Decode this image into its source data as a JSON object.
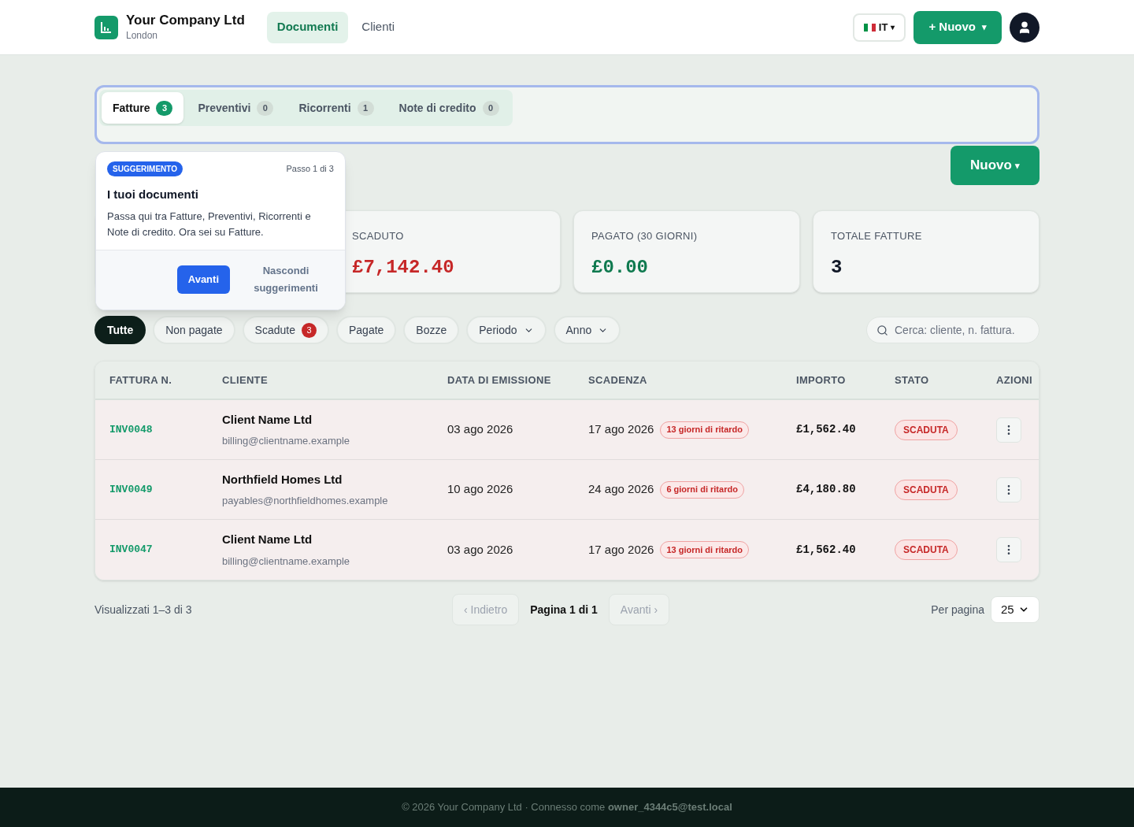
{
  "header": {
    "company": "Your Company Ltd",
    "city": "London",
    "nav": [
      {
        "label": "Documenti",
        "selected": true
      },
      {
        "label": "Clienti",
        "selected": false
      }
    ],
    "language": {
      "code": "IT",
      "caret": "▾"
    },
    "new_button": {
      "label": "+ Nuovo",
      "caret": "▾"
    }
  },
  "doc_tabs": [
    {
      "label": "Fatture",
      "count": "3",
      "selected": true
    },
    {
      "label": "Preventivi",
      "count": "0",
      "selected": false
    },
    {
      "label": "Ricorrenti",
      "count": "1",
      "selected": false
    },
    {
      "label": "Note di credito",
      "count": "0",
      "selected": false
    }
  ],
  "new_button": {
    "label": "Nuovo",
    "caret": "▾"
  },
  "tour": {
    "badge": "SUGGERIMENTO",
    "step": "Passo 1 di 3",
    "title": "I tuoi documenti",
    "body": "Passa qui tra Fatture, Preventivi, Ricorrenti e Note di credito. Ora sei su Fatture.",
    "next": "Avanti",
    "hide": "Nascondi suggerimenti"
  },
  "stats": [
    {
      "label": "SCADUTO",
      "value": "£7,142.40",
      "color": "#c62828"
    },
    {
      "label": "PAGATO (30 GIORNI)",
      "value": "£0.00",
      "color": "#0f7a4f"
    },
    {
      "label": "TOTALE FATTURE",
      "value": "3",
      "color": "#111827"
    }
  ],
  "filters": [
    {
      "label": "Tutte",
      "kind": "chip",
      "selected": true
    },
    {
      "label": "Non pagate",
      "kind": "chip",
      "selected": false
    },
    {
      "label": "Scadute",
      "kind": "chip",
      "count": "3",
      "selected": false
    },
    {
      "label": "Pagate",
      "kind": "chip",
      "selected": false
    },
    {
      "label": "Bozze",
      "kind": "chip",
      "selected": false
    },
    {
      "label": "Periodo",
      "kind": "dropdown",
      "selected": false
    },
    {
      "label": "Anno",
      "kind": "dropdown",
      "selected": false
    }
  ],
  "search": {
    "placeholder": "Cerca: cliente, n. fattura."
  },
  "table": {
    "columns": [
      "FATTURA N.",
      "CLIENTE",
      "DATA DI EMISSIONE",
      "SCADENZA",
      "IMPORTO",
      "STATO",
      "AZIONI"
    ],
    "rows": [
      {
        "number": "INV0048",
        "client": "Client Name Ltd",
        "email": "billing@clientname.example",
        "issued": "03 ago 2026",
        "due": "17 ago 2026",
        "late": "13 giorni di ritardo",
        "amount": "£1,562.40",
        "status": "SCADUTA"
      },
      {
        "number": "INV0049",
        "client": "Northfield Homes Ltd",
        "email": "payables@northfieldhomes.example",
        "issued": "10 ago 2026",
        "due": "24 ago 2026",
        "late": "6 giorni di ritardo",
        "amount": "£4,180.80",
        "status": "SCADUTA"
      },
      {
        "number": "INV0047",
        "client": "Client Name Ltd",
        "email": "billing@clientname.example",
        "issued": "03 ago 2026",
        "due": "17 ago 2026",
        "late": "13 giorni di ritardo",
        "amount": "£1,562.40",
        "status": "SCADUTA"
      }
    ]
  },
  "pagination": {
    "summary": "Visualizzati 1–3 di 3",
    "prev": {
      "label": "‹ Indietro",
      "disabled": true
    },
    "page": "Pagina 1 di 1",
    "next": {
      "label": "Avanti ›",
      "disabled": true
    },
    "per_page_label": "Per pagina",
    "per_page": "25"
  },
  "footer": "© 2026 Your Company Ltd · Connesso come **owner_4344c5@test.local**"
}
